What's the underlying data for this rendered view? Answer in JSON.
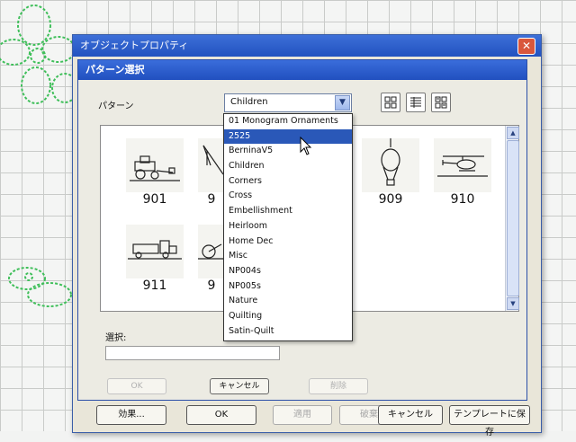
{
  "outer_window": {
    "title": "オブジェクトプロパティ",
    "close_glyph": "✕",
    "buttons": [
      {
        "label": "効果...",
        "enabled": true
      },
      {
        "label": "OK",
        "enabled": true
      },
      {
        "label": "適用",
        "enabled": false
      },
      {
        "label": "破棄",
        "enabled": false
      },
      {
        "label": "キャンセル",
        "enabled": true
      },
      {
        "label": "テンプレートに保存",
        "enabled": true
      }
    ]
  },
  "dialog": {
    "title": "パターン選択",
    "pattern_label": "パターン",
    "pattern_select_value": "Children",
    "select_arrow_glyph": "▼",
    "view_buttons": [
      "large-icons-view",
      "list-view",
      "small-icons-view"
    ],
    "selection_label": "選択:",
    "selection_value": "",
    "buttons": [
      {
        "label": "OK",
        "enabled": false
      },
      {
        "label": "キャンセル",
        "enabled": true
      },
      {
        "label": "削除",
        "enabled": false
      }
    ]
  },
  "patterns": [
    {
      "label": "901",
      "icon": "tractor-icon"
    },
    {
      "label": "9",
      "icon": "crane-icon"
    },
    {
      "label": "909",
      "icon": "hot-air-balloon-icon"
    },
    {
      "label": "910",
      "icon": "helicopter-icon"
    },
    {
      "label": "911",
      "icon": "truck-icon"
    },
    {
      "label": "9",
      "icon": "bicycle-icon"
    }
  ],
  "dropdown": {
    "selected": "2525",
    "options": [
      "01 Monogram Ornaments",
      "2525",
      "BerninaV5",
      "Children",
      "Corners",
      "Cross",
      "Embellishment",
      "Heirloom",
      "Home Dec",
      "Misc",
      "NP004s",
      "NP005s",
      "Nature",
      "Quilting",
      "Satin-Quilt"
    ]
  },
  "scrollbar": {
    "up_glyph": "▲",
    "down_glyph": "▼"
  },
  "colors": {
    "title_bar": "#2152c0",
    "selection": "#2a58b8",
    "close": "#d9573c",
    "stitch_green": "#3fbf5a"
  }
}
